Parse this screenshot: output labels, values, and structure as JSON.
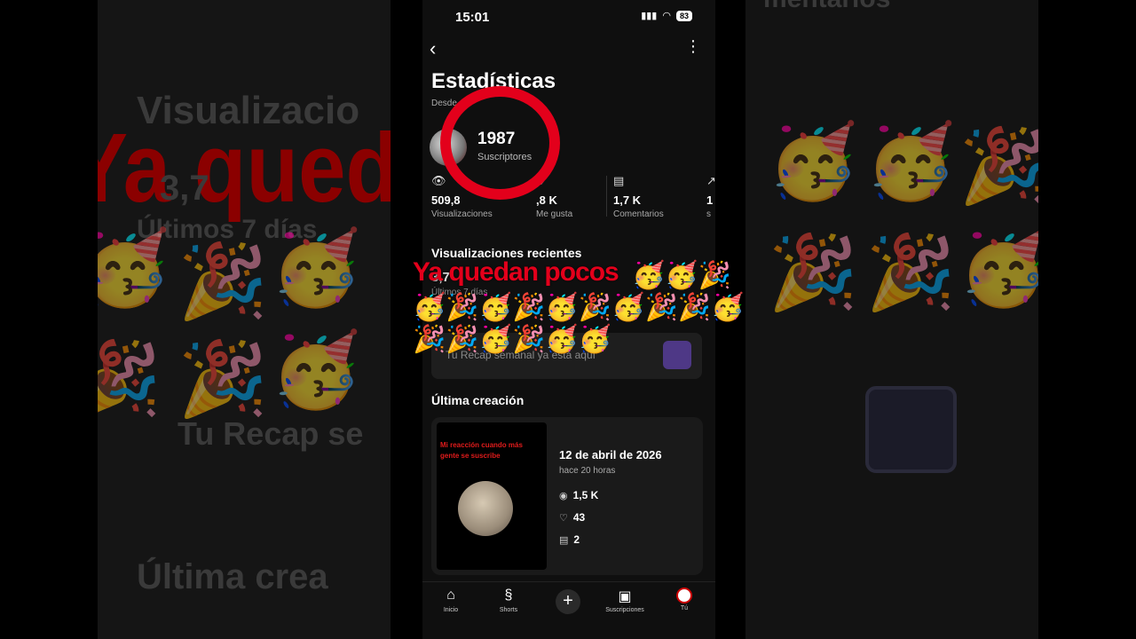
{
  "background": {
    "left_texts": [
      "Visualizacio",
      "3,7",
      "Últimos 7 días",
      "Tu Recap se",
      "Última crea"
    ],
    "right_texts": [
      "mentarios"
    ],
    "overlay_red": "Ya qued",
    "emoji": "🥳",
    "emoji_party": "🎉"
  },
  "status_bar": {
    "time": "15:01",
    "battery": "83",
    "signal": "▮▮▮",
    "wifi": "◠"
  },
  "header": {
    "back": "‹",
    "more": "⋮"
  },
  "page": {
    "title": "Estadísticas",
    "since": "Desde"
  },
  "subscribers": {
    "count": "1987",
    "label": "Suscriptores"
  },
  "stats": [
    {
      "icon": "👁",
      "value": "509,8",
      "label": "Visualizaciones"
    },
    {
      "icon": "♡",
      "value": ",8 K",
      "label": "Me gusta"
    },
    {
      "icon": "▤",
      "value": "1,7 K",
      "label": "Comentarios"
    },
    {
      "icon": "↗",
      "value": "1",
      "label": "s"
    }
  ],
  "recent": {
    "title": "Visualizaciones recientes",
    "value": "3,7",
    "sub": "Últimos 7 días"
  },
  "recap": {
    "text": "Tu Recap semanal ya está aquí"
  },
  "latest": {
    "title": "Última creación",
    "thumb_text": "Mi reacción cuando más gente se suscribe",
    "date": "12 de abril de 2026",
    "ago": "hace 20 horas",
    "views": "1,5 K",
    "likes": "43",
    "comments": "2",
    "views_icon": "◉",
    "likes_icon": "♡",
    "comments_icon": "▤"
  },
  "nav": {
    "home": "Inicio",
    "shorts": "Shorts",
    "plus": "+",
    "subscriptions": "Suscripciones",
    "you": "Tú"
  },
  "overlay": {
    "text": "Ya quedan pocos",
    "emoji_line1": "🥳🥳🎉",
    "emoji_line2": "🥳🎉🥳🎉🥳🎉🥳🎉🎉🥳",
    "emoji_line3": "🎉🎉🥳🎉🥳🥳"
  }
}
